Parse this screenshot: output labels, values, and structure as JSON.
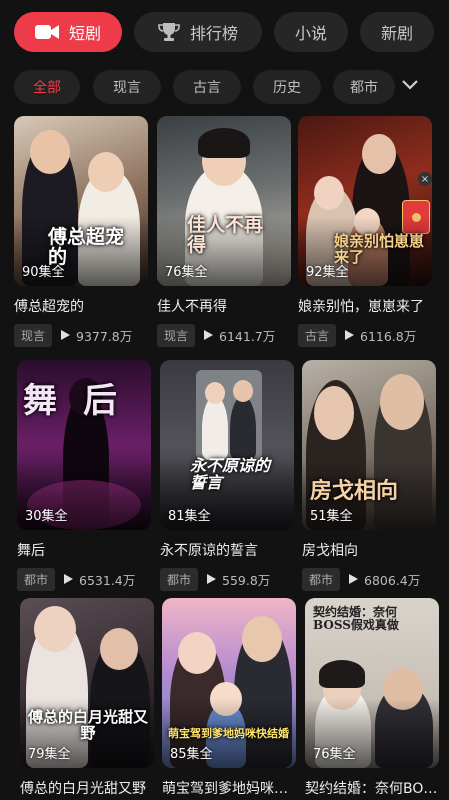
{
  "tabs": [
    {
      "label": "短剧",
      "icon": "video-camera-icon",
      "active": true
    },
    {
      "label": "排行榜",
      "icon": "trophy-icon",
      "active": false
    },
    {
      "label": "小说",
      "active": false
    },
    {
      "label": "新剧",
      "active": false
    }
  ],
  "categories": [
    {
      "label": "全部",
      "active": true
    },
    {
      "label": "现言"
    },
    {
      "label": "古言"
    },
    {
      "label": "历史"
    },
    {
      "label": "都市"
    }
  ],
  "expand_icon": "chevron-down-icon",
  "colors": {
    "accent": "#ee3b4a",
    "background": "#121212"
  },
  "dramas": [
    {
      "title": "傅总超宠的",
      "episodes": "90集全",
      "genre": "现言",
      "views": "9377.8万",
      "poster_text": "傅总超宠的"
    },
    {
      "title": "佳人不再得",
      "episodes": "76集全",
      "genre": "现言",
      "views": "6141.7万",
      "poster_text": "佳人不再得"
    },
    {
      "title": "娘亲别怕，崽崽来了",
      "episodes": "92集全",
      "genre": "古言",
      "views": "6116.8万",
      "poster_text": "娘亲别怕崽崽来了"
    },
    {
      "title": "舞后",
      "episodes": "30集全",
      "genre": "都市",
      "views": "6531.4万",
      "poster_text": "舞后"
    },
    {
      "title": "永不原谅的誓言",
      "episodes": "81集全",
      "genre": "都市",
      "views": "559.8万",
      "poster_text": "永不原谅的誓言"
    },
    {
      "title": "房戈相向",
      "episodes": "51集全",
      "genre": "都市",
      "views": "6806.4万",
      "poster_text": "房戈相向"
    },
    {
      "title": "傅总的白月光甜又野",
      "episodes": "79集全",
      "poster_text": "傅总的白月光甜又野"
    },
    {
      "title": "萌宝驾到爹地妈咪快结婚",
      "episodes": "85集全",
      "poster_text": "萌宝驾到爹地妈咪快结婚"
    },
    {
      "title": "契约结婚：奈何BOSS假戏真做",
      "episodes": "76集全",
      "poster_text": "契约结婚：奈何BOSS假戏真做"
    }
  ]
}
